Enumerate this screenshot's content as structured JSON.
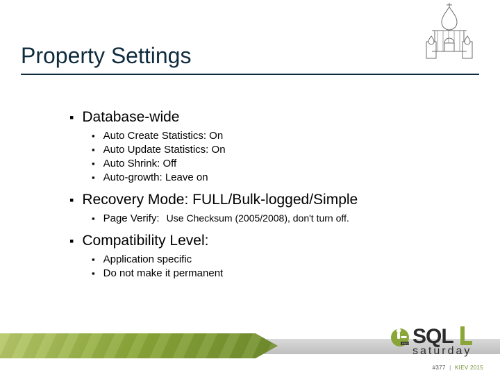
{
  "title": "Property Settings",
  "bullets": {
    "b1": {
      "label": "Database-wide"
    },
    "b1_children": [
      "Auto Create Statistics: On",
      "Auto Update Statistics: On",
      "Auto Shrink: Off",
      "Auto-growth: Leave on"
    ],
    "b2": {
      "label": "Recovery Mode: FULL/Bulk-logged/Simple"
    },
    "b2_children": [
      {
        "label": "Page Verify:",
        "note": "Use Checksum (2005/2008), don't turn off."
      }
    ],
    "b3": {
      "label": "Compatibility Level:"
    },
    "b3_children": [
      "Application specific",
      "Do not make it permanent"
    ]
  },
  "logo": {
    "pass": "PASS",
    "sql": "SQL",
    "saturday": "saturday"
  },
  "event": {
    "number": "#377",
    "city": "KIEV",
    "year": "2015"
  }
}
